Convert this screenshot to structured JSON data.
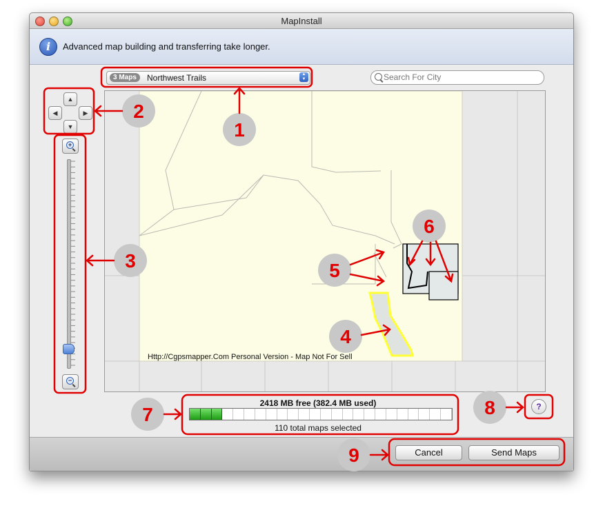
{
  "window": {
    "title": "MapInstall"
  },
  "info_bar": {
    "icon": "info-icon",
    "message": "Advanced map building and transferring take longer."
  },
  "map_select": {
    "count_badge": "3 Maps",
    "selected": "Northwest Trails"
  },
  "search": {
    "placeholder": "Search For City",
    "icon": "search-icon"
  },
  "navigation": {
    "pan": {
      "up": "▲",
      "left": "◀",
      "right": "▶",
      "down": "▼"
    },
    "zoom": {
      "in": "+",
      "out": "−",
      "level_fraction": 0.08
    }
  },
  "map": {
    "credit": "Http://Cgpsmapper.Com Personal Version - Map Not For Sell"
  },
  "storage": {
    "free_text": "2418 MB free (382.4 MB used)",
    "used_fraction": 0.137,
    "selection_text": "110 total maps selected"
  },
  "help": {
    "label": "?"
  },
  "buttons": {
    "cancel": "Cancel",
    "send": "Send Maps"
  },
  "callouts": [
    "1",
    "2",
    "3",
    "4",
    "5",
    "6",
    "7",
    "8",
    "9"
  ],
  "colors": {
    "annotation": "#e00000",
    "map_land": "#fdfde6",
    "selection_highlight": "#ffff33",
    "progress_fill": "#2fbf24"
  }
}
